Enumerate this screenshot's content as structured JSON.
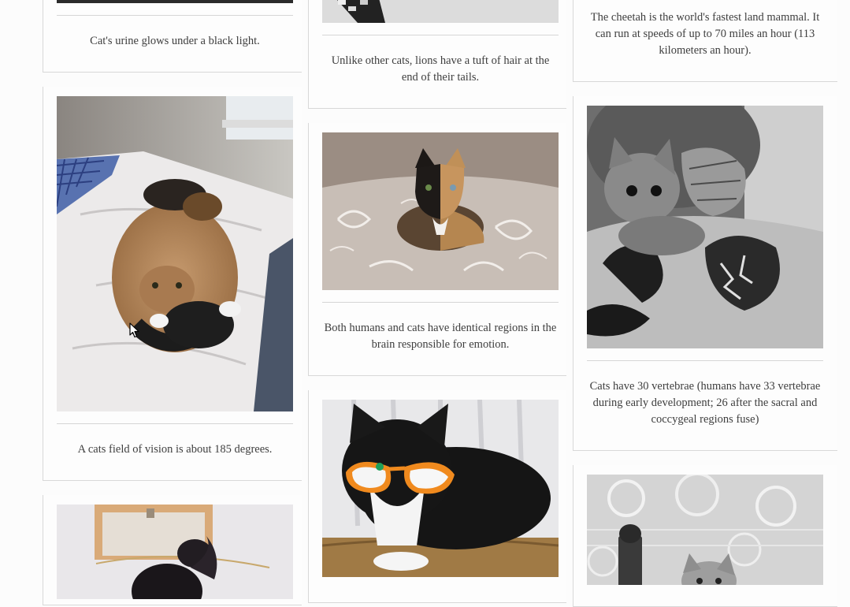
{
  "cards": [
    {
      "id": "urine",
      "caption": "Cat's urine glows under a black light.",
      "image": "cat-photo-partial-top"
    },
    {
      "id": "vision",
      "caption": "A cats field of vision is about 185 degrees.",
      "image": "orange-cat-on-bed"
    },
    {
      "id": "black-cat",
      "caption": "",
      "image": "black-fluffy-cat"
    },
    {
      "id": "lions",
      "caption": "Unlike other cats, lions have a tuft of hair at the end of their tails.",
      "image": "cat-photo-partial-top"
    },
    {
      "id": "emotion",
      "caption": "Both humans and cats have identical regions in the brain responsible for emotion.",
      "image": "chimera-cat-on-bedspread"
    },
    {
      "id": "sunglasses",
      "caption": "",
      "image": "tuxedo-cat-with-orange-sunglasses"
    },
    {
      "id": "cheetah",
      "caption": "The cheetah is the world's fastest land mammal. It can run at speeds of up to 70 miles an hour (113 kilometers an hour).",
      "image": ""
    },
    {
      "id": "vertebrae",
      "caption": "Cats have 30 vertebrae (humans have 33 vertebrae during early development; 26 after the sacral and coccygeal regions fuse)",
      "image": "kitten-with-tattooed-arm"
    },
    {
      "id": "lace",
      "caption": "",
      "image": "kitten-with-lace-curtain"
    }
  ]
}
